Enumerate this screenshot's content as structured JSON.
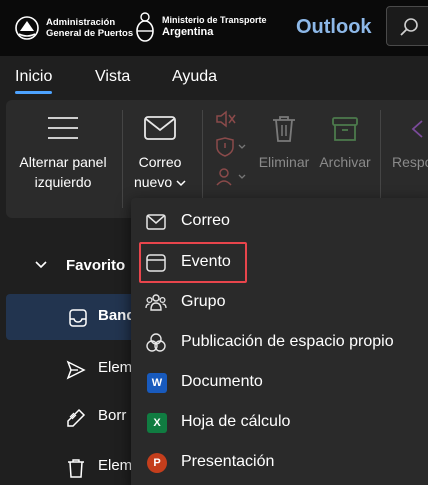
{
  "header": {
    "org1_line1": "Administración",
    "org1_line2": "General de Puertos",
    "org2_line1": "Ministerio de Transporte",
    "org2_line2": "Argentina",
    "brand": "Outlook"
  },
  "tabs": [
    {
      "label": "Inicio",
      "active": true
    },
    {
      "label": "Vista",
      "active": false
    },
    {
      "label": "Ayuda",
      "active": false
    }
  ],
  "ribbon": {
    "toggle_pane_line1": "Alternar panel",
    "toggle_pane_line2": "izquierdo",
    "new_mail_line1": "Correo",
    "new_mail_line2": "nuevo",
    "delete": "Eliminar",
    "archive": "Archivar",
    "reply_partial": "Respo"
  },
  "nav": {
    "favorites": "Favorito",
    "items": [
      {
        "label": "Band",
        "icon": "inbox-icon",
        "selected": true
      },
      {
        "label": "Elem",
        "icon": "send-icon",
        "selected": false
      },
      {
        "label": "Borr",
        "icon": "draft-pencil-icon",
        "selected": false
      },
      {
        "label": "Elem",
        "icon": "trash-icon",
        "selected": false
      }
    ]
  },
  "new_menu": {
    "items": [
      {
        "label": "Correo",
        "icon": "mail-icon"
      },
      {
        "label": "Evento",
        "icon": "calendar-icon",
        "highlighted": true
      },
      {
        "label": "Grupo",
        "icon": "group-icon"
      },
      {
        "label": "Publicación de espacio propio",
        "icon": "loop-icon"
      },
      {
        "label": "Documento",
        "icon": "word-icon"
      },
      {
        "label": "Hoja de cálculo",
        "icon": "excel-icon"
      },
      {
        "label": "Presentación",
        "icon": "powerpoint-icon"
      }
    ]
  },
  "colors": {
    "accent": "#4da3ff",
    "brand": "#8db8e8",
    "highlight_border": "#e8454c",
    "word": "#185abd",
    "excel": "#107c41",
    "powerpoint": "#c43e1c"
  }
}
